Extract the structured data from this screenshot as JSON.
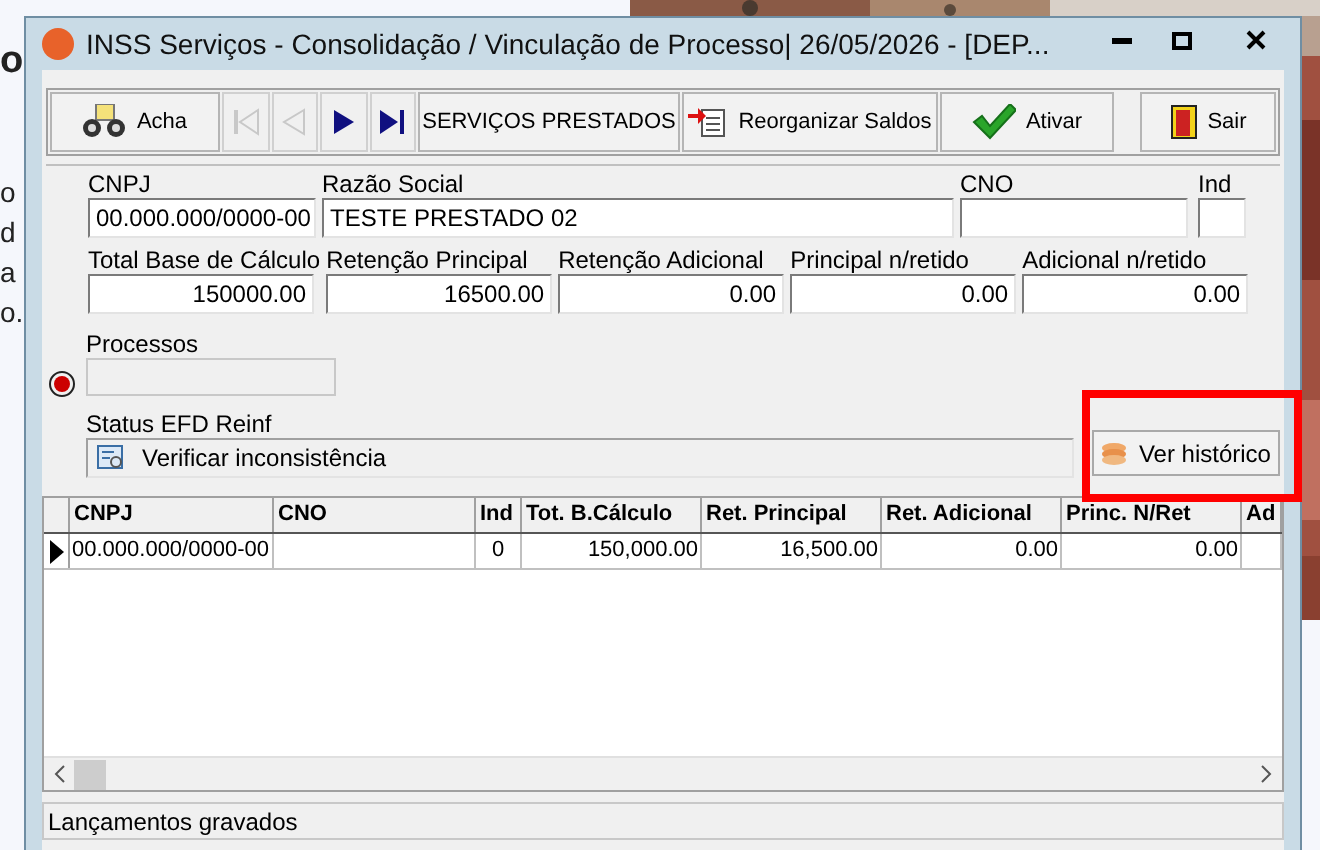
{
  "background": {
    "texts": [
      "o",
      "o",
      "d",
      "a",
      "o."
    ]
  },
  "window": {
    "title": "INSS Serviços - Consolidação / Vinculação de Processo|  26/05/2026 - [DEP..."
  },
  "toolbar": [
    {
      "kind": "button",
      "label": "Acha"
    },
    {
      "kind": "nav",
      "disabled": true
    },
    {
      "kind": "nav",
      "disabled": true
    },
    {
      "kind": "nav",
      "disabled": false
    },
    {
      "kind": "nav",
      "disabled": false
    },
    {
      "kind": "button",
      "label": "SERVIÇOS PRESTADOS"
    },
    {
      "kind": "button",
      "label": "Reorganizar Saldos"
    },
    {
      "kind": "button",
      "label": "Ativar"
    },
    {
      "kind": "button",
      "label": "Sair"
    }
  ],
  "form": {
    "row1": [
      {
        "label": "CNPJ",
        "value": "00.000.000/0000-00"
      },
      {
        "label": "Razão Social",
        "value": "TESTE PRESTADO 02"
      },
      {
        "label": "CNO"
      },
      {
        "label": "Ind"
      }
    ],
    "row2": [
      {
        "label": "Total Base de Cálculo",
        "value": "150000.00"
      },
      {
        "label": "Retenção Principal",
        "value": "16500.00"
      },
      {
        "label": "Retenção Adicional",
        "value": "0.00"
      },
      {
        "label": "Principal n/retido",
        "value": "0.00"
      },
      {
        "label": "Adicional n/retido",
        "value": "0.00"
      }
    ],
    "processos": {
      "label": "Processos",
      "disabled": true
    },
    "status": {
      "label": "Status EFD Reinf",
      "value": "Verificar inconsistência"
    },
    "history_button": {
      "label": "Ver histórico",
      "highlighted": true
    }
  },
  "table": {
    "columns": [
      "CNPJ",
      "CNO",
      "Ind",
      "Tot. B.Cálculo",
      "Ret. Principal",
      "Ret. Adicional",
      "Princ. N/Ret",
      "Ad"
    ],
    "rows": [
      {
        "selected": true,
        "cells": [
          "00.000.000/0000-00",
          "",
          "0",
          "150,000.00",
          "16,500.00",
          "0.00",
          "0.00",
          ""
        ]
      }
    ]
  },
  "status_bar": "Lançamentos gravados"
}
